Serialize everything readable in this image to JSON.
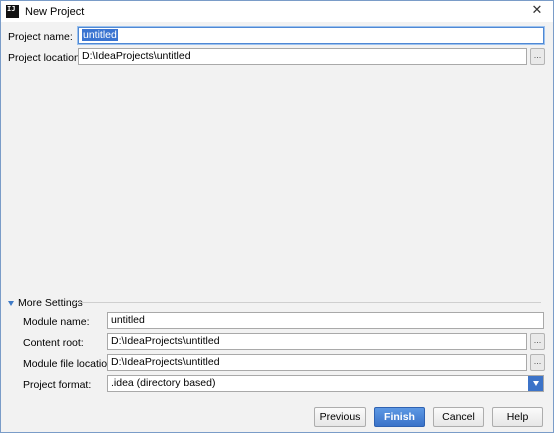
{
  "window": {
    "title": "New Project",
    "icon_text": "IJ",
    "close_glyph": "✕"
  },
  "project": {
    "name_label": "Project name:",
    "name_value": "untitled",
    "location_label": "Project location:",
    "location_value": "D:\\IdeaProjects\\untitled",
    "browse_label": "..."
  },
  "more_settings": {
    "label": "More Settings",
    "module_name_label": "Module name:",
    "module_name_value": "untitled",
    "content_root_label": "Content root:",
    "content_root_value": "D:\\IdeaProjects\\untitled",
    "module_file_label": "Module file location:",
    "module_file_value": "D:\\IdeaProjects\\untitled",
    "format_label": "Project format:",
    "format_value": ".idea (directory based)",
    "browse_label": "..."
  },
  "buttons": {
    "previous": "Previous",
    "finish": "Finish",
    "cancel": "Cancel",
    "help": "Help"
  },
  "colors": {
    "accent": "#3a74d1",
    "background": "#f2f2f2"
  }
}
